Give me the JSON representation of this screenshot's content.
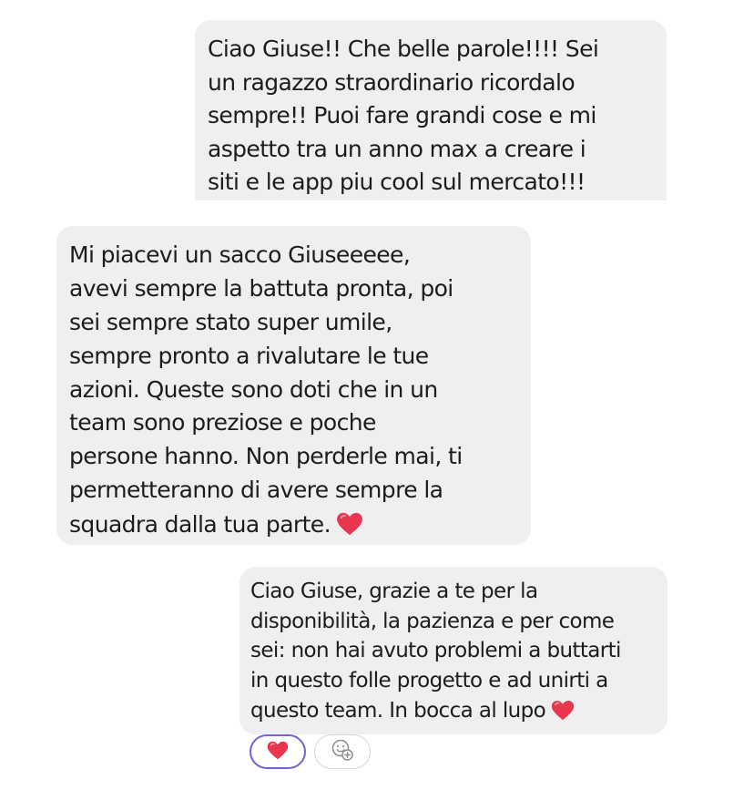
{
  "messages": [
    {
      "id": "msg1",
      "lines": [
        "Ciao Giuse!! Che belle parole!!!! Sei",
        "un ragazzo straordinario ricordalo",
        "sempre!! Puoi fare grandi cose e mi",
        "aspetto tra un anno max a creare i",
        "siti e le app piu cool sul mercato!!!"
      ]
    },
    {
      "id": "msg2",
      "lines": [
        "Mi piacevi un sacco Giuseeeee,",
        "avevi sempre la battuta pronta, poi",
        "sei sempre stato super umile,",
        "sempre pronto a rivalutare le tue",
        "azioni. Queste sono doti che in un",
        "team sono preziose e poche",
        "persone hanno. Non perderle mai, ti",
        "permetteranno di avere sempre la",
        "squadra dalla tua parte."
      ],
      "trailing_icon": "red-heart-emoji"
    },
    {
      "id": "msg3",
      "lines": [
        "Ciao Giuse, grazie a te per la",
        "disponibilità, la pazienza e per come",
        "sei: non hai avuto problemi a buttarti",
        "in questo folle progetto e ad unirti a",
        "questo team. In bocca al lupo"
      ],
      "trailing_icon": "red-heart-emoji"
    }
  ],
  "reactions": {
    "heart": {
      "icon": "heart-reaction-icon",
      "selected": true
    },
    "add": {
      "icon": "add-reaction-icon"
    }
  },
  "colors": {
    "bubble": "#efeff1",
    "text": "#1c1c1e",
    "heart": "#e8364f",
    "selected_border": "#6f62d7"
  }
}
